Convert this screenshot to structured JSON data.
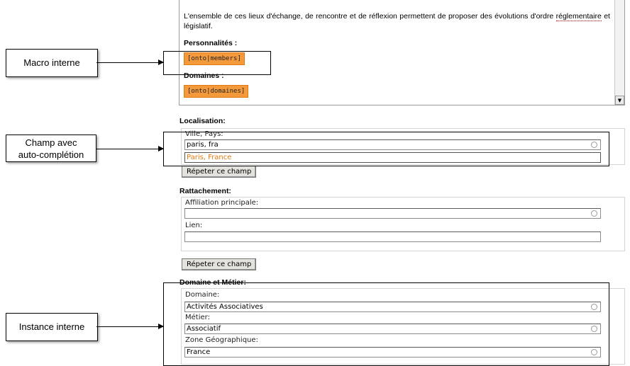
{
  "editor": {
    "paragraph_before": "L'ensemble de ces lieux d'échange, de rencontre et de réflexion permettent de proposer des évolutions d'ordre ",
    "paragraph_spell": "réglementaire",
    "paragraph_after": " et législatif.",
    "heading_personalities": "Personnalités :",
    "macro_members": "[onto|members]",
    "heading_domains": "Domaines :",
    "macro_domains": "[onto|domaines]",
    "scroll_down_glyph": "▼"
  },
  "localisation": {
    "title": "Localisation:",
    "field_label": "Ville, Pays:",
    "field_value": "paris, fra",
    "suggestion": "Paris, France",
    "repeat_button": "Répeter ce champ"
  },
  "rattachement": {
    "title": "Rattachement:",
    "affiliation_label": "Affiliation principale:",
    "affiliation_value": "",
    "lien_label": "Lien:",
    "lien_value": "",
    "repeat_button": "Répeter ce champ"
  },
  "domaine_metier": {
    "title": "Domaine et Métier:",
    "domaine_label": "Domaine:",
    "domaine_value": "Activités Associatives",
    "metier_label": "Métier:",
    "metier_value": "Associatif",
    "zone_label": "Zone Géographique:",
    "zone_value": "France"
  },
  "annotations": {
    "macro": "Macro interne",
    "autocomplete_line1": "Champ avec",
    "autocomplete_line2": "auto-complétion",
    "instance": "Instance interne"
  }
}
